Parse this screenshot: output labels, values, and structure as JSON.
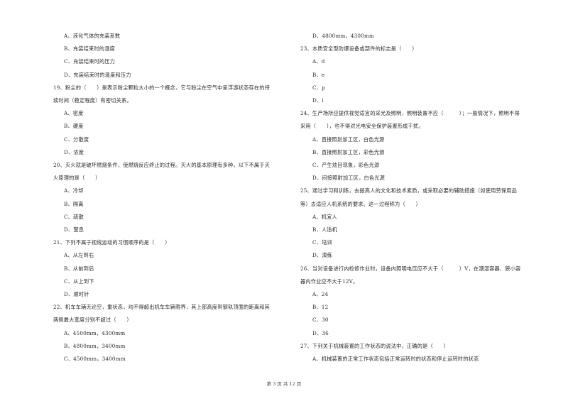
{
  "left_column": [
    {
      "type": "option",
      "text": "A、液化气体的充装系数"
    },
    {
      "type": "option",
      "text": "B、充装结束时的温度"
    },
    {
      "type": "option",
      "text": "C、充装结束时的压力"
    },
    {
      "type": "option",
      "text": "D、充装结束时的温度和压力"
    },
    {
      "type": "question",
      "text": "19、粉尘的（　　）是表示粉尘颗粒大小的一个概念，它与粉尘在空气中呈浮游状态存在的持"
    },
    {
      "type": "question-cont",
      "text": "续时间（稳定程度）有密切关系。"
    },
    {
      "type": "option",
      "text": "A、密度"
    },
    {
      "type": "option",
      "text": "B、硬度"
    },
    {
      "type": "option",
      "text": "C、分散度"
    },
    {
      "type": "option",
      "text": "D、浓度"
    },
    {
      "type": "question",
      "text": "20、灭火就是破坏燃烧条件，使燃烧反应终止的过程。灭火的基本原理有多种，以下不属于灭"
    },
    {
      "type": "question-cont",
      "text": "火原理的是（　　）"
    },
    {
      "type": "option",
      "text": "A、冷却"
    },
    {
      "type": "option",
      "text": "B、隔离"
    },
    {
      "type": "option",
      "text": "C、疏散"
    },
    {
      "type": "option",
      "text": "D、窒息"
    },
    {
      "type": "question",
      "text": "21、下列不属于视线运动的习惯顺序的是（　　）"
    },
    {
      "type": "option",
      "text": "A、从左到右"
    },
    {
      "type": "option",
      "text": "B、从前到后"
    },
    {
      "type": "option",
      "text": "C、从上到下"
    },
    {
      "type": "option",
      "text": "D、顺时针"
    },
    {
      "type": "question",
      "text": "22、机车车辆无论空，重状态，均不得超出机车车辆限界，其上部高度到钢轨顶面的距离和其"
    },
    {
      "type": "question-cont",
      "text": "两侧最大宽度分别不超过（　　）"
    },
    {
      "type": "option",
      "text": "A、4500mm，4300mm"
    },
    {
      "type": "option",
      "text": "B、4800mm，3400mm"
    },
    {
      "type": "option",
      "text": "C、4500mm，3400mm"
    }
  ],
  "right_column": [
    {
      "type": "option",
      "text": "D、4800mm，4300mm"
    },
    {
      "type": "question",
      "text": "23、本质安全型防爆设备或部件的标志是（　　）"
    },
    {
      "type": "option",
      "text": "A、d"
    },
    {
      "type": "option",
      "text": "B、e"
    },
    {
      "type": "option",
      "text": "C、p"
    },
    {
      "type": "option",
      "text": "D、i"
    },
    {
      "type": "question",
      "text": "24、生产场所应提供视觉适宜的采光及照明，照明装置不应（　　　）；一般情况下，照明不得"
    },
    {
      "type": "question-cont",
      "text": "采用（　　），也不得对光电安全保护装置形成干扰。"
    },
    {
      "type": "option",
      "text": "A、直接照射加工区，白色光源"
    },
    {
      "type": "option",
      "text": "B、直接照射加工区，彩色光源"
    },
    {
      "type": "option",
      "text": "C、产生炫目现象，彩色光源"
    },
    {
      "type": "option",
      "text": "D、间接照射加工区，白色光源"
    },
    {
      "type": "question",
      "text": "25、通过学习和训练，去提高人的文化和技术素质，或采取必要的辅助措施（如使用劳保用品"
    },
    {
      "type": "question-cont",
      "text": "等）去适应人机系统的要求。这一过程称为（　　）"
    },
    {
      "type": "option",
      "text": "A、机宜人"
    },
    {
      "type": "option",
      "text": "B、人适机"
    },
    {
      "type": "option",
      "text": "C、培训"
    },
    {
      "type": "option",
      "text": "D、演练"
    },
    {
      "type": "question",
      "text": "26、当对设备进行内检修作业时，设备内照明电压应不大于（　　　）V，在潮湿容器、狭小容"
    },
    {
      "type": "question-cont",
      "text": "器内作业应不大于12V。"
    },
    {
      "type": "option",
      "text": "A、24"
    },
    {
      "type": "option",
      "text": "B、12"
    },
    {
      "type": "option",
      "text": "C、30"
    },
    {
      "type": "option",
      "text": "D、36"
    },
    {
      "type": "question",
      "text": "27、下列关于机械装置的工作状态的说法中，正确的是（　　）"
    },
    {
      "type": "option",
      "text": "A、机械装置的正常工作状态包括正常运转时的状态和停止运转时的状态"
    }
  ],
  "footer": {
    "page_label": "第 3 页 共 12 页"
  }
}
